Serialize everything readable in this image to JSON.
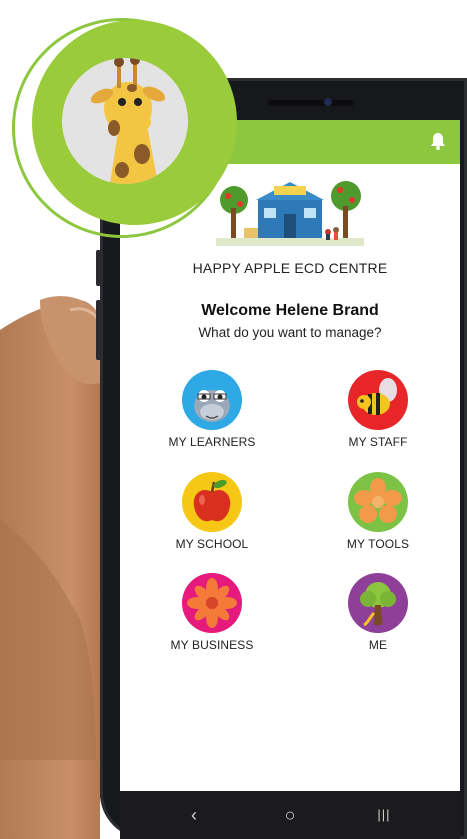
{
  "header": {
    "bell_icon": "bell-icon",
    "brand_color": "#8dc63f"
  },
  "school": {
    "name": "HAPPY APPLE ECD CENTRE"
  },
  "greeting": {
    "welcome": "Welcome Helene Brand",
    "question": "What do you want to manage?"
  },
  "menu": [
    {
      "label": "MY LEARNERS",
      "icon": "hippo-icon",
      "color": "#2fa8e6"
    },
    {
      "label": "MY STAFF",
      "icon": "bee-icon",
      "color": "#e8262a"
    },
    {
      "label": "MY SCHOOL",
      "icon": "apple-icon",
      "color": "#f6c715"
    },
    {
      "label": "MY TOOLS",
      "icon": "flower-icon",
      "color": "#7cc244"
    },
    {
      "label": "MY BUSINESS",
      "icon": "flower-icon",
      "color": "#e6197d"
    },
    {
      "label": "ME",
      "icon": "tree-icon",
      "color": "#8e3f97"
    }
  ],
  "navbar": {
    "back": "‹",
    "home": "○",
    "recents": "|||"
  }
}
